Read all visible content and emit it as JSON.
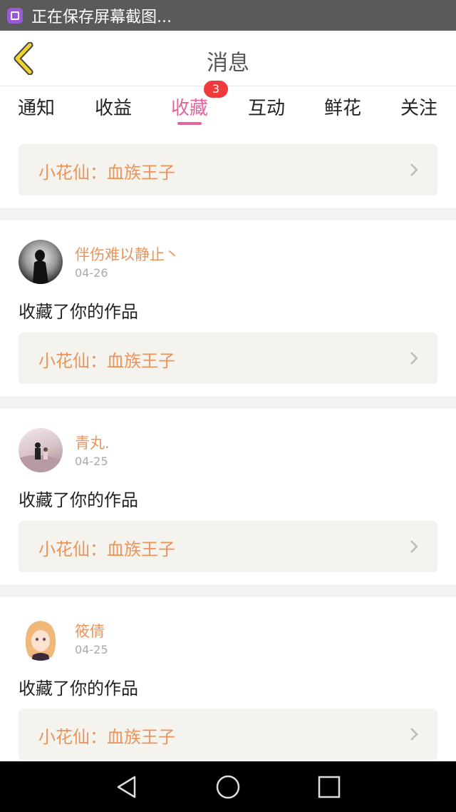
{
  "status_bar": {
    "text": "正在保存屏幕截图..."
  },
  "header": {
    "title": "消息"
  },
  "tabs": [
    {
      "label": "通知"
    },
    {
      "label": "收益"
    },
    {
      "label": "收藏",
      "active": true,
      "badge": "3"
    },
    {
      "label": "互动"
    },
    {
      "label": "鲜花"
    },
    {
      "label": "关注"
    }
  ],
  "top_item": {
    "work": "小花仙：血族王子"
  },
  "items": [
    {
      "user": "伴伤难以静止丶",
      "date": "04-26",
      "action": "收藏了你的作品",
      "work": "小花仙：血族王子"
    },
    {
      "user": "青丸.",
      "date": "04-25",
      "action": "收藏了你的作品",
      "work": "小花仙：血族王子"
    },
    {
      "user": "筱倩",
      "date": "04-25",
      "action": "收藏了你的作品",
      "work": "小花仙：血族王子"
    }
  ],
  "colors": {
    "accent_pink": "#e2649b",
    "username_orange": "#e8955c",
    "badge_red": "#ef3b3b"
  }
}
